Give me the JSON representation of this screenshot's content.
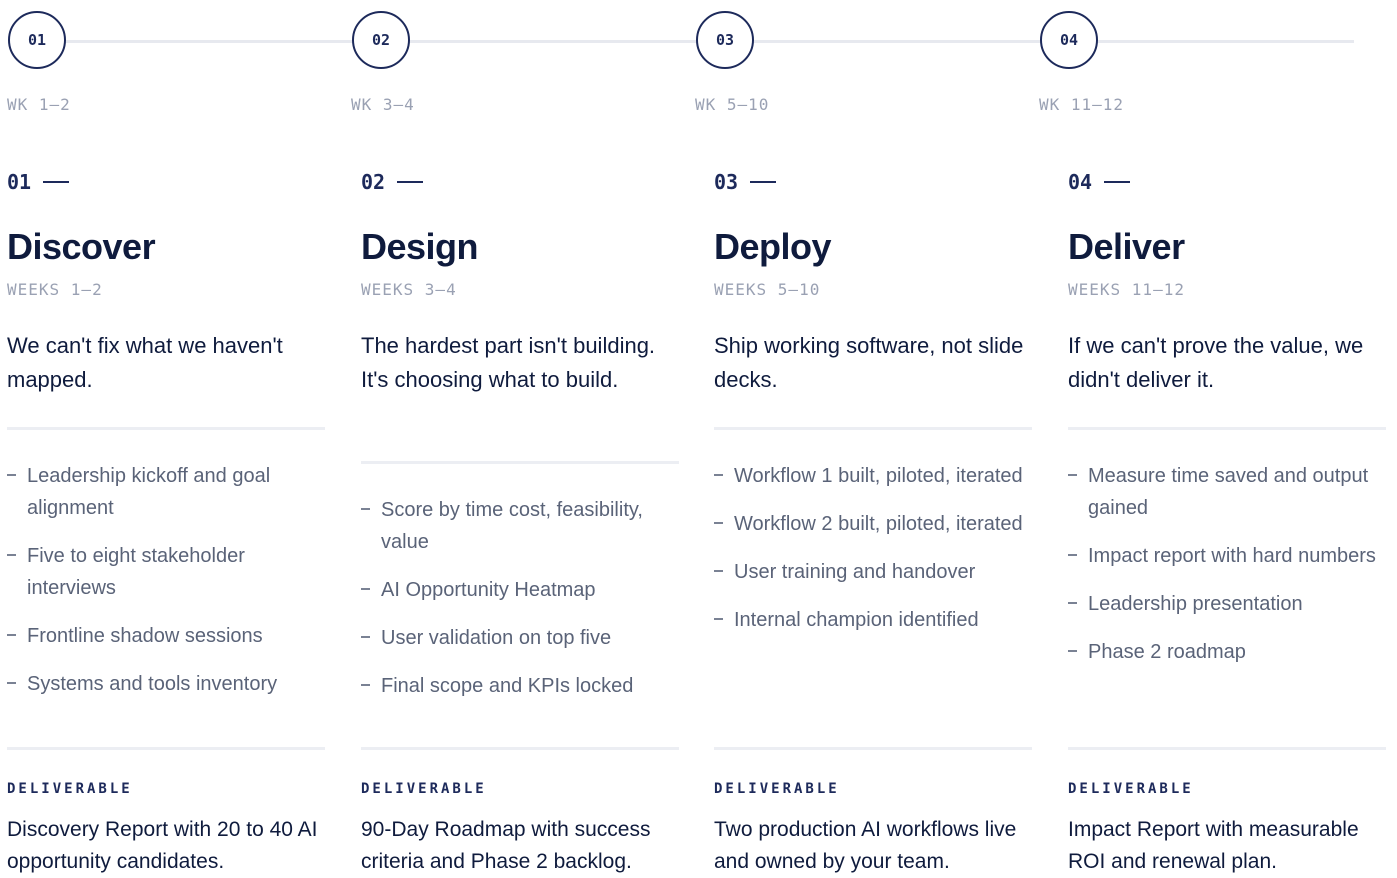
{
  "timeline": {
    "nodes": [
      {
        "num": "01",
        "weeks": "WK 1–2"
      },
      {
        "num": "02",
        "weeks": "WK 3–4"
      },
      {
        "num": "03",
        "weeks": "WK 5–10"
      },
      {
        "num": "04",
        "weeks": "WK 11–12"
      }
    ]
  },
  "phases": [
    {
      "num": "01",
      "title": "Discover",
      "weeks": "WEEKS 1–2",
      "tagline": "We can't fix what we haven't mapped.",
      "tasks": [
        "Leadership kickoff and goal alignment",
        "Five to eight stakeholder interviews",
        "Frontline shadow sessions",
        "Systems and tools inventory"
      ],
      "deliverable_label": "DELIVERABLE",
      "deliverable": "Discovery Report with 20 to 40 AI opportunity candidates."
    },
    {
      "num": "02",
      "title": "Design",
      "weeks": "WEEKS 3–4",
      "tagline": "The hardest part isn't building. It's choosing what to build.",
      "tasks": [
        "Score by time cost, feasibility, value",
        "AI Opportunity Heatmap",
        "User validation on top five",
        "Final scope and KPIs locked"
      ],
      "deliverable_label": "DELIVERABLE",
      "deliverable": "90-Day Roadmap with success criteria and Phase 2 backlog."
    },
    {
      "num": "03",
      "title": "Deploy",
      "weeks": "WEEKS 5–10",
      "tagline": "Ship working software, not slide decks.",
      "tasks": [
        "Workflow 1 built, piloted, iterated",
        "Workflow 2 built, piloted, iterated",
        "User training and handover",
        "Internal champion identified"
      ],
      "deliverable_label": "DELIVERABLE",
      "deliverable": "Two production AI workflows live and owned by your team."
    },
    {
      "num": "04",
      "title": "Deliver",
      "weeks": "WEEKS 11–12",
      "tagline": "If we can't prove the value, we didn't deliver it.",
      "tasks": [
        "Measure time saved and output gained",
        "Impact report with hard numbers",
        "Leadership presentation",
        "Phase 2 roadmap"
      ],
      "deliverable_label": "DELIVERABLE",
      "deliverable": "Impact Report with measurable ROI and renewal plan."
    }
  ]
}
